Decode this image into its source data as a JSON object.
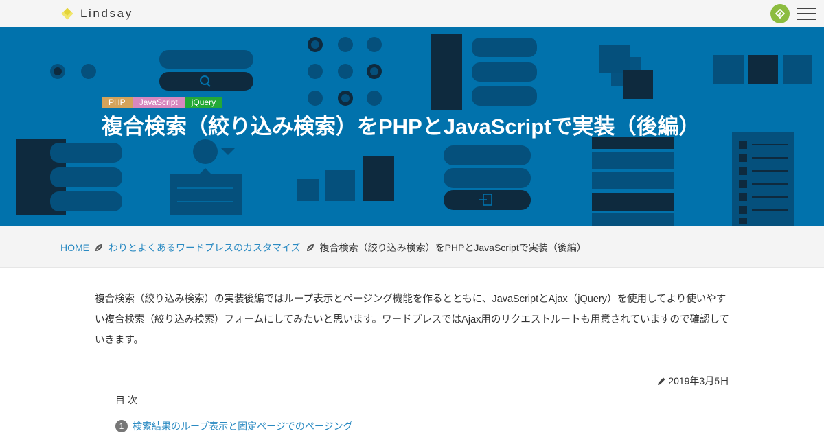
{
  "site": {
    "name": "Lindsay"
  },
  "header": {
    "menu_icon": "hamburger-icon",
    "feed_icon": "feedly-icon"
  },
  "hero": {
    "tags": [
      "PHP",
      "JavaScript",
      "jQuery"
    ],
    "title": "複合検索（絞り込み検索）をPHPとJavaScriptで実装（後編）",
    "background_color": "#0172ac"
  },
  "breadcrumb": {
    "home": "HOME",
    "category": "わりとよくあるワードプレスのカスタマイズ",
    "current": "複合検索（絞り込み検索）をPHPとJavaScriptで実装（後編）"
  },
  "article": {
    "intro": "複合検索（絞り込み検索）の実装後編ではループ表示とページング機能を作るとともに、JavaScriptとAjax（jQuery）を使用してより使いやすい複合検索（絞り込み検索）フォームにしてみたいと思います。ワードプレスではAjax用のリクエストルートも用意されていますので確認していきます。",
    "date": "2019年3月5日"
  },
  "toc": {
    "title": "目次",
    "items": [
      {
        "number": "1",
        "label": "検索結果のループ表示と固定ページでのページング"
      }
    ]
  }
}
